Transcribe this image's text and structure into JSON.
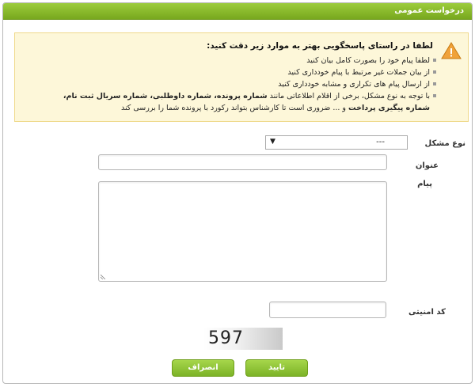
{
  "window": {
    "title": "درخواست عمومی"
  },
  "notice": {
    "heading": "لطفا در راستای پاسخگویی بهتر به موارد زیر دقت کنید:",
    "items": [
      "لطفا پیام خود را بصورت کامل بیان کنید",
      "از بیان جملات غیر مرتبط با پیام خودداری کنید",
      "از ارسال پیام های تکراری و مشابه خودداری کنید"
    ],
    "item4": {
      "prefix": "با توجه به نوع مشکل، برخی از اقلام اطلاعاتی مانند",
      "bold1": "شماره پرونده، شماره داوطلبی، شماره سریال ثبت نام، شماره پیگیری پرداخت",
      "suffix": "و ... ضروری است تا کارشناس بتواند رکورد با پرونده شما را بررسی کند"
    }
  },
  "form": {
    "problem_type": {
      "label": "نوع مشکل",
      "selected": "---"
    },
    "subject": {
      "label": "عنوان",
      "value": ""
    },
    "message": {
      "label": "پیام",
      "value": ""
    },
    "security_code": {
      "label": "کد امنیتی",
      "value": ""
    },
    "captcha_text": "597"
  },
  "buttons": {
    "confirm": "تایید",
    "cancel": "انصراف"
  },
  "colors": {
    "accent": "#8cbf2f",
    "notice_bg": "#fdf7d9",
    "notice_border": "#efd98a"
  }
}
